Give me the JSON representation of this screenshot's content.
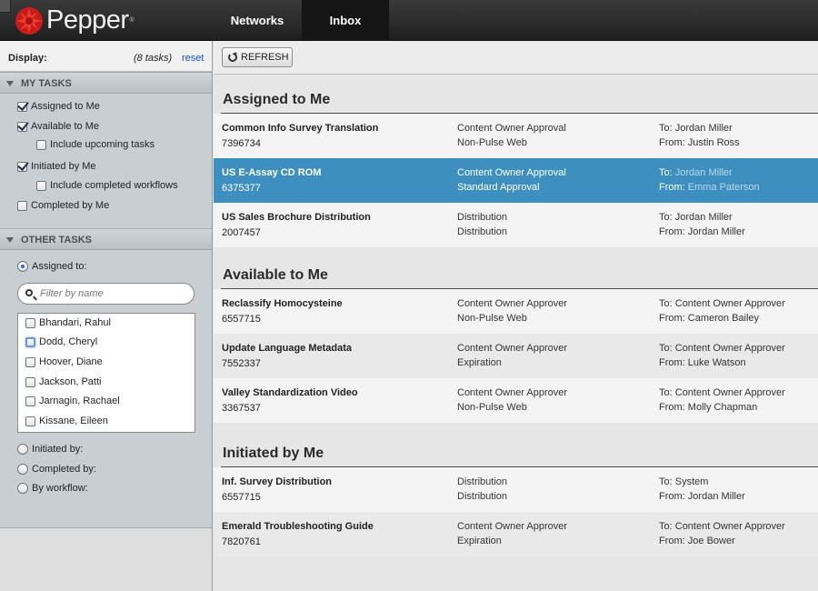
{
  "app": {
    "brand": "Pepper",
    "brand_mark": "®",
    "nav_tabs": [
      {
        "label": "Networks",
        "active": false
      },
      {
        "label": "Inbox",
        "active": true
      }
    ]
  },
  "sidebar": {
    "display_label": "Display:",
    "task_count": "(8 tasks)",
    "reset_label": "reset",
    "my_tasks": {
      "header": "MY TASKS",
      "options": [
        {
          "label": "Assigned to Me",
          "checked": true
        },
        {
          "label": "Available to Me",
          "checked": true
        },
        {
          "label": "Include upcoming tasks",
          "checked": false
        },
        {
          "label": "Initiated by Me",
          "checked": true
        },
        {
          "label": "Include completed workflows",
          "checked": false
        },
        {
          "label": "Completed by Me",
          "checked": false
        }
      ]
    },
    "other_tasks": {
      "header": "OTHER TASKS",
      "assigned_to_label": "Assigned to:",
      "filter_placeholder": "Filter by name",
      "people": [
        {
          "name": "Bhandari, Rahul",
          "checked": false
        },
        {
          "name": "Dodd, Cheryl",
          "checked": false,
          "focused": true
        },
        {
          "name": "Hoover, Diane",
          "checked": false
        },
        {
          "name": "Jackson, Patti",
          "checked": false
        },
        {
          "name": "Jarnagin, Rachael",
          "checked": false
        },
        {
          "name": "Kissane, Eileen",
          "checked": false
        }
      ],
      "initiated_by_label": "Initiated by:",
      "completed_by_label": "Completed by:",
      "by_workflow_label": "By workflow:"
    }
  },
  "toolbar": {
    "refresh_label": "REFRESH"
  },
  "groups": [
    {
      "title": "Assigned to Me",
      "tasks": [
        {
          "name": "Common Info Survey Translation",
          "id": "7396734",
          "stage": "Content Owner Approval",
          "sub": "Non-Pulse Web",
          "to_label": "To:",
          "to": "Jordan Miller",
          "from_label": "From:",
          "from": "Justin Ross",
          "selected": false
        },
        {
          "name": "US E-Assay CD ROM",
          "id": "6375377",
          "stage": "Content Owner Approval",
          "sub": "Standard Approval",
          "to_label": "To:",
          "to": "Jordan Miller",
          "from_label": "From:",
          "from": "Emma Paterson",
          "selected": true
        },
        {
          "name": "US Sales Brochure Distribution",
          "id": "2007457",
          "stage": "Distribution",
          "sub": "Distribution",
          "to_label": "To:",
          "to": "Jordan Miller",
          "from_label": "From:",
          "from": "Jordan Miller",
          "selected": false
        }
      ]
    },
    {
      "title": "Available to Me",
      "tasks": [
        {
          "name": "Reclassify Homocysteine",
          "id": "6557715",
          "stage": "Content Owner Approver",
          "sub": "Non-Pulse Web",
          "to_label": "To:",
          "to": "Content Owner Approver",
          "from_label": "From:",
          "from": "Cameron Bailey",
          "selected": false
        },
        {
          "name": "Update Language Metadata",
          "id": "7552337",
          "stage": "Content Owner Approver",
          "sub": "Expiration",
          "to_label": "To:",
          "to": "Content Owner Approver",
          "from_label": "From:",
          "from": "Luke Watson",
          "selected": false
        },
        {
          "name": "Valley Standardization Video",
          "id": "3367537",
          "stage": "Content Owner Approver",
          "sub": "Non-Pulse Web",
          "to_label": "To:",
          "to": "Content Owner Approver",
          "from_label": "From:",
          "from": "Molly Chapman",
          "selected": false
        }
      ]
    },
    {
      "title": "Initiated by Me",
      "tasks": [
        {
          "name": "Inf. Survey Distribution",
          "id": "6557715",
          "stage": "Distribution",
          "sub": "Distribution",
          "to_label": "To:",
          "to": "System",
          "from_label": "From:",
          "from": "Jordan Miller",
          "selected": false
        },
        {
          "name": "Emerald Troubleshooting Guide",
          "id": "7820761",
          "stage": "Content Owner Approver",
          "sub": "Expiration",
          "to_label": "To:",
          "to": "Content Owner Approver",
          "from_label": "From:",
          "from": "Joe Bower",
          "selected": false
        }
      ]
    }
  ],
  "colors": {
    "selected_row": "#3d8fc0",
    "brand_red": "#d8231f",
    "link_blue": "#1a52c6"
  }
}
